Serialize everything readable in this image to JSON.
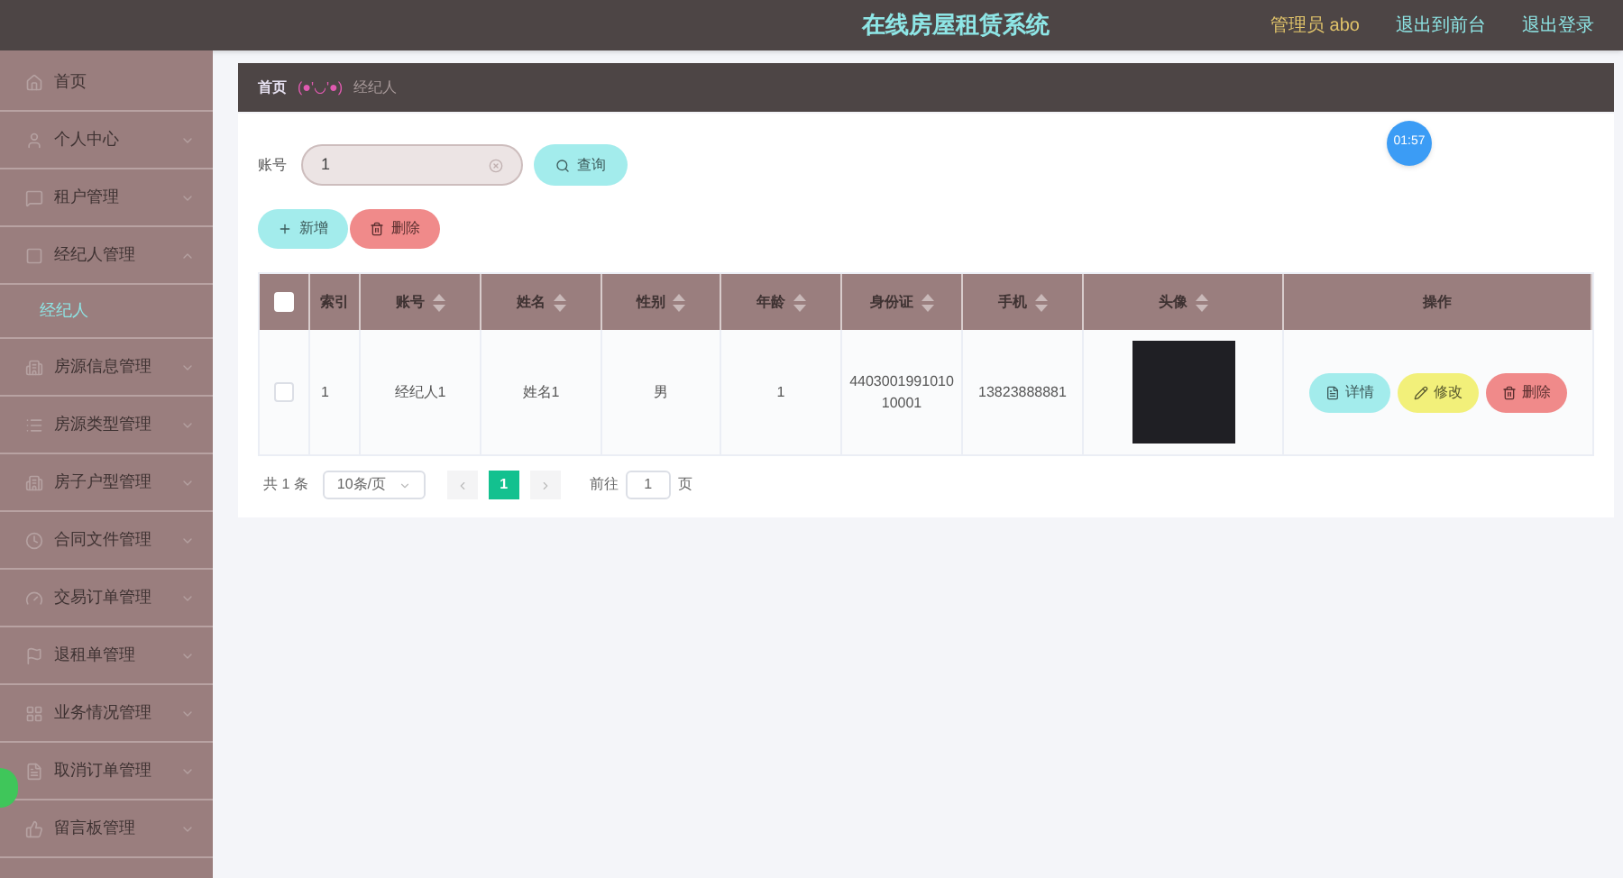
{
  "header": {
    "title": "在线房屋租赁系统",
    "admin_label": "管理员 abo",
    "links": [
      "退出到前台",
      "退出登录"
    ]
  },
  "sidebar": {
    "items": [
      {
        "label": "首页"
      },
      {
        "label": "个人中心",
        "expanded": false
      },
      {
        "label": "租户管理",
        "expanded": false
      },
      {
        "label": "经纪人管理",
        "expanded": true,
        "children": [
          {
            "label": "经纪人",
            "selected": true
          }
        ]
      },
      {
        "label": "房源信息管理",
        "expanded": false
      },
      {
        "label": "房源类型管理",
        "expanded": false
      },
      {
        "label": "房子户型管理",
        "expanded": false
      },
      {
        "label": "合同文件管理",
        "expanded": false
      },
      {
        "label": "交易订单管理",
        "expanded": false
      },
      {
        "label": "退租单管理",
        "expanded": false
      },
      {
        "label": "业务情况管理",
        "expanded": false
      },
      {
        "label": "取消订单管理",
        "expanded": false
      },
      {
        "label": "留言板管理",
        "expanded": false
      }
    ]
  },
  "breadcrumb": {
    "home": "首页",
    "separator": "(●'◡'●)",
    "current": "经纪人"
  },
  "search": {
    "label": "账号",
    "value": "1",
    "button": "查询"
  },
  "actions": [
    {
      "kind": "add",
      "label": "新增"
    },
    {
      "kind": "delete",
      "label": "删除"
    }
  ],
  "table": {
    "select_all_checked": false,
    "columns": [
      {
        "label": "索引",
        "sortable": false
      },
      {
        "label": "账号",
        "sortable": true
      },
      {
        "label": "姓名",
        "sortable": true
      },
      {
        "label": "性别",
        "sortable": true
      },
      {
        "label": "年龄",
        "sortable": true
      },
      {
        "label": "身份证",
        "sortable": true
      },
      {
        "label": "手机",
        "sortable": true
      },
      {
        "label": "头像",
        "sortable": true
      },
      {
        "label": "操作",
        "sortable": false
      }
    ],
    "rows": [
      {
        "checked": false,
        "cells": [
          "1",
          "经纪人1",
          "姓名1",
          "男",
          "1",
          "440300199101010001",
          "13823888881"
        ],
        "actions": [
          {
            "kind": "detail",
            "label": "详情"
          },
          {
            "kind": "edit",
            "label": "修改"
          },
          {
            "kind": "delete",
            "label": "删除"
          }
        ]
      }
    ]
  },
  "pagination": {
    "total": "共 1 条",
    "page_size": "10条/页",
    "pages": [
      {
        "label": "1",
        "selected": true
      }
    ],
    "goto_label": "前往",
    "goto_value": "1",
    "page_unit": "页"
  },
  "timer_badge": "01:57"
}
